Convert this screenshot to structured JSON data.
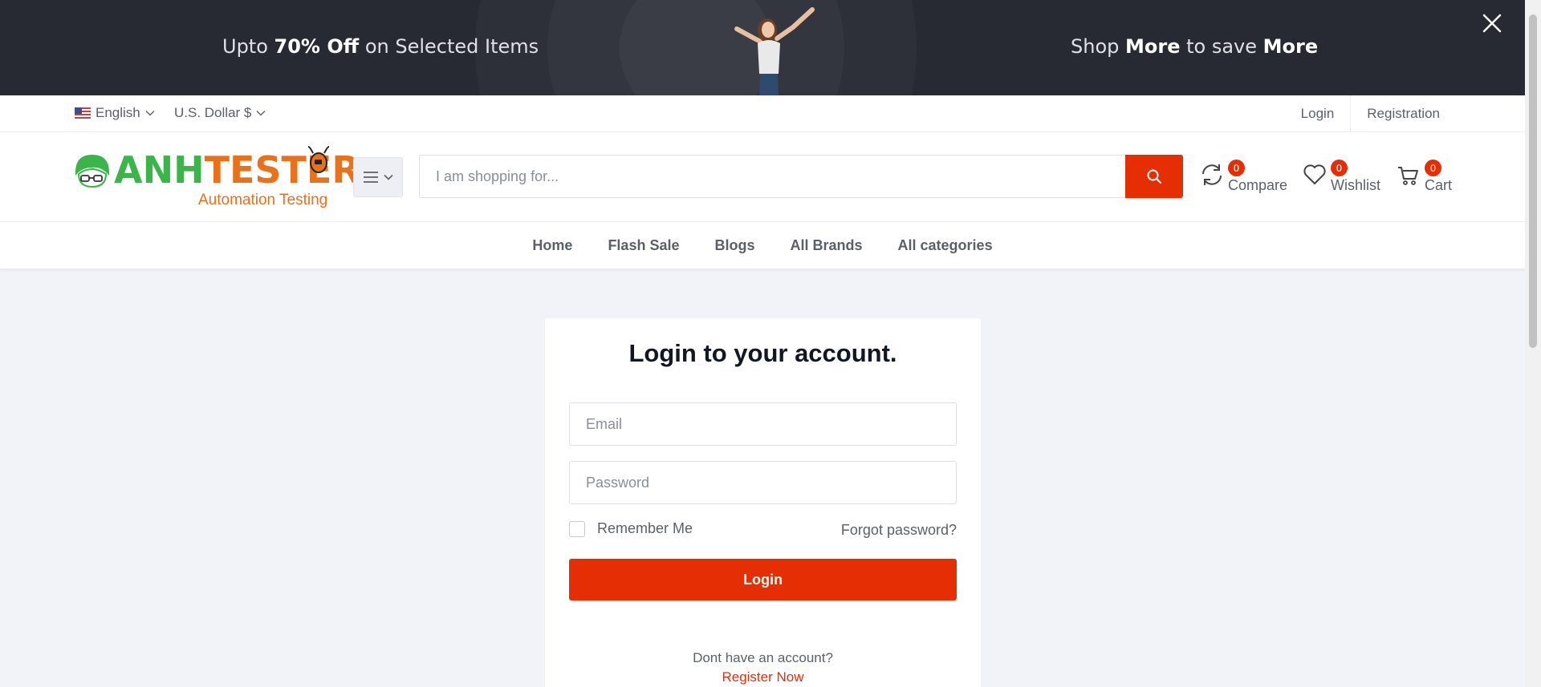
{
  "banner": {
    "left_prefix": "Upto ",
    "left_bold": "70% Off",
    "left_suffix": " on Selected Items",
    "right_prefix": "Shop ",
    "right_bold1": "More",
    "right_middle": " to save ",
    "right_bold2": "More"
  },
  "topbar": {
    "language": "English",
    "currency": "U.S. Dollar $",
    "login": "Login",
    "registration": "Registration"
  },
  "logo": {
    "brand_green": "ANH",
    "brand_orange": "TESTER",
    "tagline": "Automation Testing"
  },
  "search": {
    "placeholder": "I am shopping for..."
  },
  "header_icons": {
    "compare": {
      "label": "Compare",
      "count": "0"
    },
    "wishlist": {
      "label": "Wishlist",
      "count": "0"
    },
    "cart": {
      "label": "Cart",
      "count": "0"
    }
  },
  "nav": {
    "items": [
      "Home",
      "Flash Sale",
      "Blogs",
      "All Brands",
      "All categories"
    ]
  },
  "login_form": {
    "title": "Login to your account.",
    "email_placeholder": "Email",
    "password_placeholder": "Password",
    "remember": "Remember Me",
    "forgot": "Forgot password?",
    "submit": "Login",
    "no_account": "Dont have an account?",
    "register": "Register Now"
  },
  "colors": {
    "accent": "#e62e04",
    "banner_bg": "#272a33",
    "brand_green": "#3bb54a",
    "brand_orange": "#e8711c",
    "page_bg": "#f2f3f8"
  }
}
